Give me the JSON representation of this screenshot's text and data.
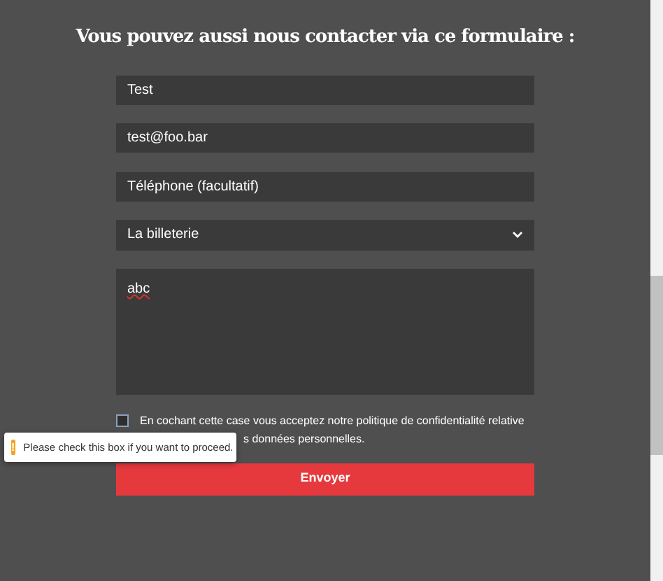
{
  "heading": "Vous pouvez aussi nous contacter via ce formulaire :",
  "form": {
    "name": {
      "value": "Test"
    },
    "email": {
      "value": "test@foo.bar"
    },
    "phone": {
      "placeholder": "Téléphone (facultatif)"
    },
    "topic": {
      "value": "La billeterie"
    },
    "message": {
      "value": "abc"
    },
    "consent": {
      "checked": false,
      "line_1": "En cochant cette case vous acceptez notre politique de confidentialité relative",
      "line_2": "s données personnelles."
    },
    "submit": "Envoyer"
  },
  "tooltip": {
    "text": "Please check this box if you want to proceed.",
    "icon": "!"
  }
}
